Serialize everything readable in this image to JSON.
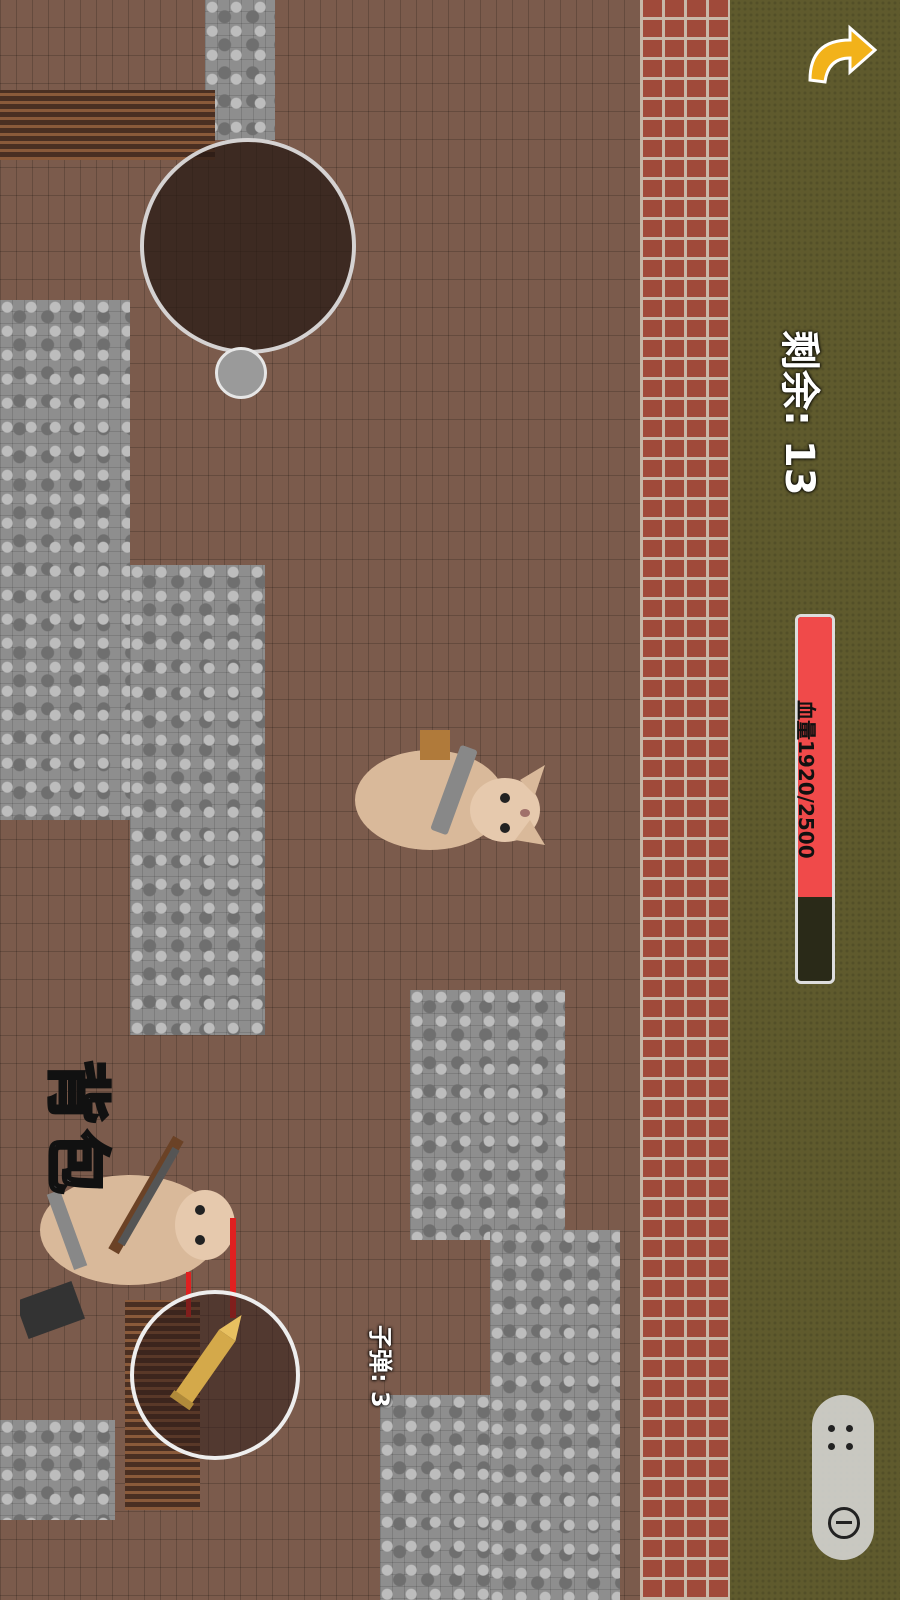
{
  "hud": {
    "remaining_label": "剩余: 13",
    "hp_label": "血量1920/2500",
    "hp_value": 1920,
    "hp_max": 2500,
    "ammo_label": "子弹: 3",
    "backpack_label": "背包"
  },
  "icons": {
    "back": "back-arrow-icon",
    "more": "more-dots-icon",
    "close": "close-circle-icon",
    "bullet": "bullet-icon"
  },
  "colors": {
    "hp_fill": "#f04a4a",
    "hp_empty": "#2a2a18"
  }
}
